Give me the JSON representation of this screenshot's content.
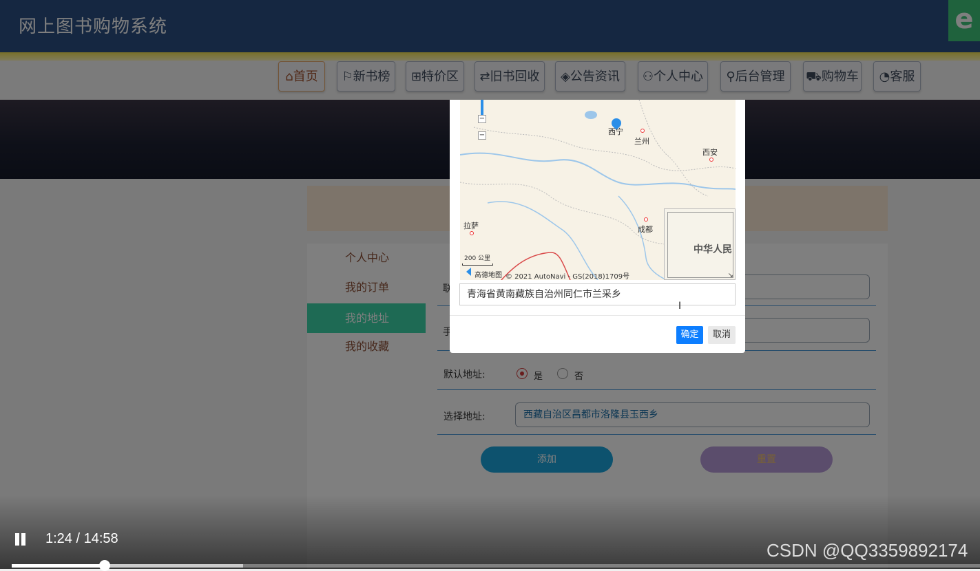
{
  "app": {
    "title": "网上图书购物系统",
    "badge": "e"
  },
  "nav": [
    {
      "icon": "⌂",
      "label": "首页"
    },
    {
      "icon": "⚐",
      "label": "新书榜"
    },
    {
      "icon": "⊞",
      "label": "特价区"
    },
    {
      "icon": "⇄",
      "label": "旧书回收"
    },
    {
      "icon": "◈",
      "label": "公告资讯"
    },
    {
      "icon": "⚇",
      "label": "个人中心"
    },
    {
      "icon": "⚲",
      "label": "后台管理"
    },
    {
      "icon": "⛟",
      "label": "购物车"
    },
    {
      "icon": "◔",
      "label": "客服"
    }
  ],
  "sidebar": [
    {
      "label": "个人中心"
    },
    {
      "label": "我的订单"
    },
    {
      "label": "我的地址"
    },
    {
      "label": "我的收藏"
    }
  ],
  "form": {
    "row1_label": "联",
    "row2_label": "手",
    "default_label": "默认地址:",
    "radio_yes": "是",
    "radio_no": "否",
    "select_label": "选择地址:",
    "select_value": "西藏自治区昌都市洛隆县玉西乡",
    "add_button": "添加",
    "reset_button": "重置"
  },
  "map": {
    "cities": [
      {
        "name": "西宁"
      },
      {
        "name": "兰州"
      },
      {
        "name": "西安"
      },
      {
        "name": "拉萨"
      },
      {
        "name": "成都"
      }
    ],
    "scale": "200 公里",
    "attribution": "© 2021 AutoNavi - GS(2018)1709号",
    "logo": "高德地图",
    "minimap_label": "中华人民"
  },
  "dialog": {
    "address": "青海省黄南藏族自治州同仁市兰采乡",
    "ok": "确定",
    "cancel": "取消"
  },
  "video": {
    "time": "1:24 / 14:58",
    "progress": 0.096,
    "buffered": 0.239,
    "watermark": "CSDN @QQ3359892174"
  },
  "colors": {
    "header": "#2b4f82",
    "sidebar_active": "#3cd4a8",
    "confirm": "#0d7eff"
  }
}
